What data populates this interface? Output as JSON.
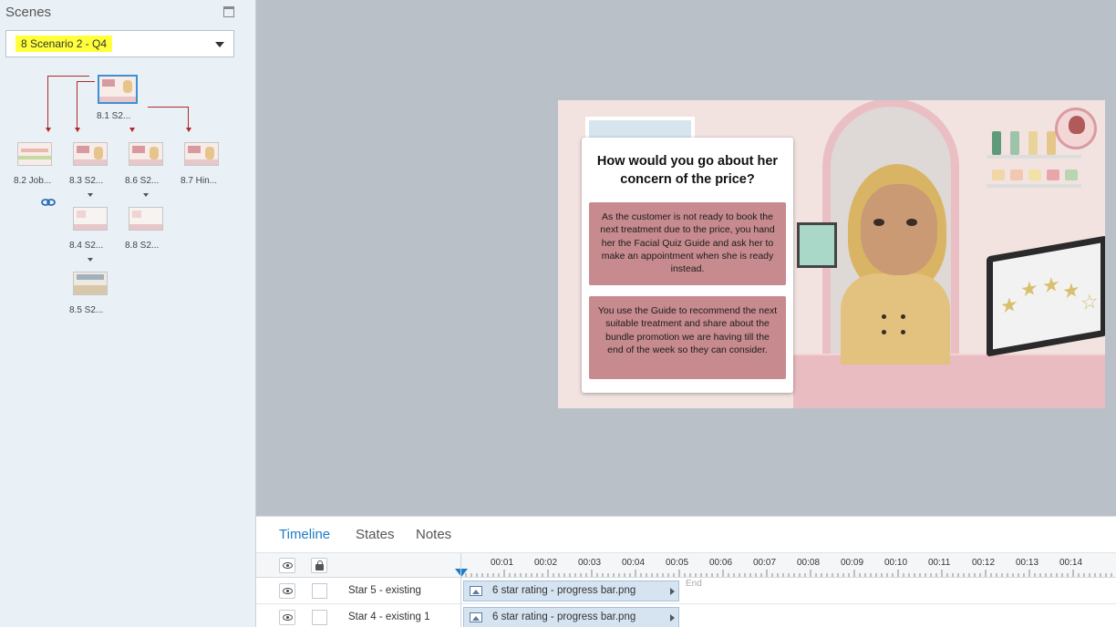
{
  "scenes": {
    "title": "Scenes",
    "selected_scene": "8 Scenario 2 - Q4",
    "slides": [
      {
        "label": "8.1 S2..."
      },
      {
        "label": "8.2 Job..."
      },
      {
        "label": "8.3 S2..."
      },
      {
        "label": "8.6 S2..."
      },
      {
        "label": "8.7 Hin..."
      },
      {
        "label": "8.4 S2..."
      },
      {
        "label": "8.8 S2..."
      },
      {
        "label": "8.5 S2..."
      }
    ]
  },
  "slide": {
    "question": "How would you go about her concern of the price?",
    "options": [
      "As the customer is not ready to book the next treatment due to the price, you hand her the Facial Quiz Guide and ask her to make an appointment when she is ready instead.",
      "You use the Guide to recommend the next suitable treatment and share about the bundle promotion we are having till the end of the week so they can consider."
    ],
    "colors": {
      "option_bg": "#c78a8e",
      "card_bg": "#ffffff",
      "scene_bg": "#f2e3e1"
    }
  },
  "timeline": {
    "tabs": [
      "Timeline",
      "States",
      "Notes"
    ],
    "active_tab": "Timeline",
    "ticks": [
      "00:01",
      "00:02",
      "00:03",
      "00:04",
      "00:05",
      "00:06",
      "00:07",
      "00:08",
      "00:09",
      "00:10",
      "00:11",
      "00:12",
      "00:13",
      "00:14"
    ],
    "end_label": "End",
    "rows": [
      {
        "name": "Star 5 - existing",
        "bar_label": "6 star rating - progress bar.png"
      },
      {
        "name": "Star 4 - existing 1",
        "bar_label": "6 star rating - progress bar.png"
      }
    ],
    "accent": "#1f7cc6"
  }
}
